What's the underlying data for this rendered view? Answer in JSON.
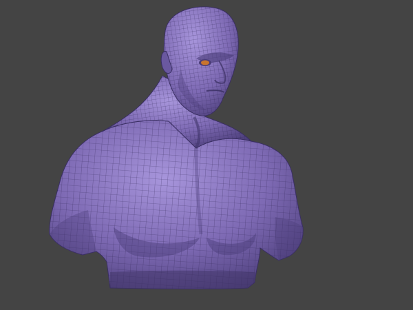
{
  "viewport": {
    "background": "#444444",
    "model": {
      "kind": "sculpted male bust with polygon wireframe overlay",
      "material_color": "#7E6AB4",
      "shadow_color": "#4A3C78",
      "highlight_color": "#A795DB",
      "wire_color": "#2E2452",
      "eye_color": "#C9742E"
    }
  }
}
